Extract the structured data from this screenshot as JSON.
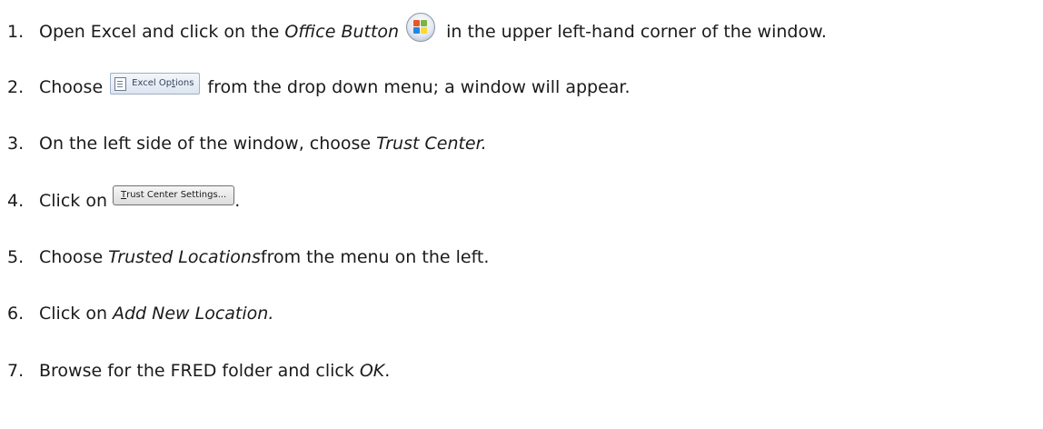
{
  "steps": [
    {
      "num": "1.",
      "parts": [
        "Open Excel and click on the ",
        "Office Button",
        "in the upper left-hand corner of the window."
      ]
    },
    {
      "num": "2.",
      "parts": [
        "Choose",
        "from the drop down menu; a window will appear."
      ]
    },
    {
      "num": "3.",
      "parts": [
        "On the left side of the window, choose ",
        "Trust Center."
      ]
    },
    {
      "num": "4.",
      "parts": [
        "Click on",
        "."
      ]
    },
    {
      "num": "5.",
      "parts": [
        "Choose ",
        "Trusted Locations",
        " from the menu on the left."
      ]
    },
    {
      "num": "6.",
      "parts": [
        "Click on ",
        "Add New Location."
      ]
    },
    {
      "num": "7.",
      "parts": [
        "Browse for the FRED folder and click ",
        "OK",
        "."
      ]
    }
  ],
  "buttons": {
    "office_icon": "office-button-icon",
    "excel_options_first": "Excel Op",
    "excel_options_underline": "t",
    "excel_options_rest": "ions",
    "trust_underline": "T",
    "trust_rest": "rust Center Settings..."
  },
  "colors": {
    "text": "#1a1a1a",
    "office_orange": "#e8572a",
    "office_green": "#7cb342",
    "office_blue": "#1e88e5",
    "office_yellow": "#fdd835"
  }
}
